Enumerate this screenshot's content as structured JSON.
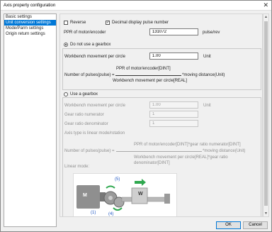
{
  "window": {
    "title": "Axis property configuration",
    "close_glyph": "✕"
  },
  "nav": {
    "items": [
      {
        "label": "Basic settings",
        "selected": false
      },
      {
        "label": "Unit conversion settings",
        "selected": true
      },
      {
        "label": "Mode/Parm settings",
        "selected": false
      },
      {
        "label": "Origin return settings",
        "selected": false
      }
    ]
  },
  "options": {
    "reverse_label": "Reverse",
    "reverse_checked": false,
    "decimal_label": "Decimal display pulse number",
    "decimal_checked": true
  },
  "ppr": {
    "label": "PPR of motor/encoder",
    "value": "131072",
    "unit": "pulse/rev"
  },
  "no_gearbox": {
    "label": "Do not use a gearbox",
    "selected": true,
    "movement_label": "Workbench movement per circle",
    "movement_value": "1.00",
    "movement_unit": "Unit",
    "formula_numerator": "PPR of motor/encoder[DINT]",
    "formula_left": "Number of pulses(pulse) =",
    "formula_right": "*moving distance(Unit)",
    "formula_denominator": "Workbench movement per circle[REAL]"
  },
  "gearbox": {
    "label": "Use a gearbox",
    "selected": false,
    "movement_label": "Workbench movement per circle",
    "movement_value": "1.00",
    "movement_unit": "Unit",
    "numerator_label": "Gear ratio numerator",
    "numerator_value": "1",
    "denominator_label": "Gear ratio denominator",
    "denominator_value": "1",
    "axis_type_text": "Axis type is linear mode/rotation",
    "formula_numerator": "PPR of motor/encoder[DINT]*gear ratio numerator[DINT]",
    "formula_left": "Number of pulses(pulse) =",
    "formula_right": "*moving distance(Unit)",
    "formula_denominator_1": "Workbench movement per circle[REAL]*gear ratio",
    "formula_denominator_2": "denominator[DINT]",
    "mode_label": "Linear mode:"
  },
  "figure": {
    "motor_label": "M",
    "work_label": "W",
    "label_1": "(1)",
    "label_4": "(4)",
    "label_5": "(5)"
  },
  "footer": {
    "ok_label": "OK",
    "cancel_label": "Cancel"
  },
  "colors": {
    "accent": "#0078d7",
    "label_blue": "#1f57c3",
    "arrow_green": "#2fa84f"
  }
}
